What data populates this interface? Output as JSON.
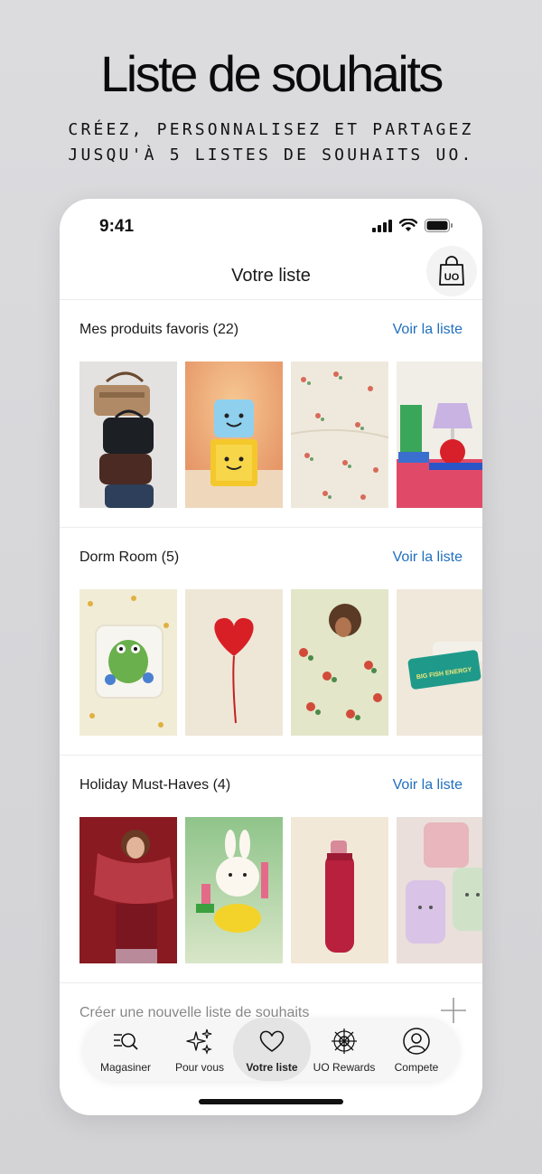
{
  "promo": {
    "title": "Liste de souhaits",
    "subtitle_line1": "CRÉEZ, PERSONNALISEZ ET PARTAGEZ",
    "subtitle_line2": "JUSQU'À 5 LISTES DE SOUHAITS UO."
  },
  "status_bar": {
    "time": "9:41"
  },
  "header": {
    "title": "Votre liste",
    "bag_icon": "uo-bag-icon"
  },
  "sections": [
    {
      "title": "Mes produits favoris (22)",
      "link": "Voir la liste",
      "thumbs": [
        "bags-stack",
        "cube-toy",
        "floral-sheet",
        "lamp-books"
      ]
    },
    {
      "title": "Dorm Room (5)",
      "link": "Voir la liste",
      "thumbs": [
        "frog-pillow",
        "heart-balloon",
        "floral-bedding",
        "candle-tin"
      ]
    },
    {
      "title": "Holiday Must-Haves (4)",
      "link": "Voir la liste",
      "thumbs": [
        "red-scarf",
        "bunny-figure",
        "water-bottle",
        "bunny-bags"
      ]
    }
  ],
  "new_list": {
    "label": "Créer une nouvelle liste de souhaits"
  },
  "tabbar": {
    "items": [
      {
        "label": "Magasiner",
        "icon": "search-list-icon"
      },
      {
        "label": "Pour vous",
        "icon": "sparkles-icon"
      },
      {
        "label": "Votre liste",
        "icon": "heart-icon",
        "active": true
      },
      {
        "label": "UO Rewards",
        "icon": "rewards-icon"
      },
      {
        "label": "Compete",
        "icon": "account-icon"
      }
    ]
  },
  "colors": {
    "link": "#1f6fbf",
    "background": "#d8d8db",
    "card": "#ffffff"
  }
}
